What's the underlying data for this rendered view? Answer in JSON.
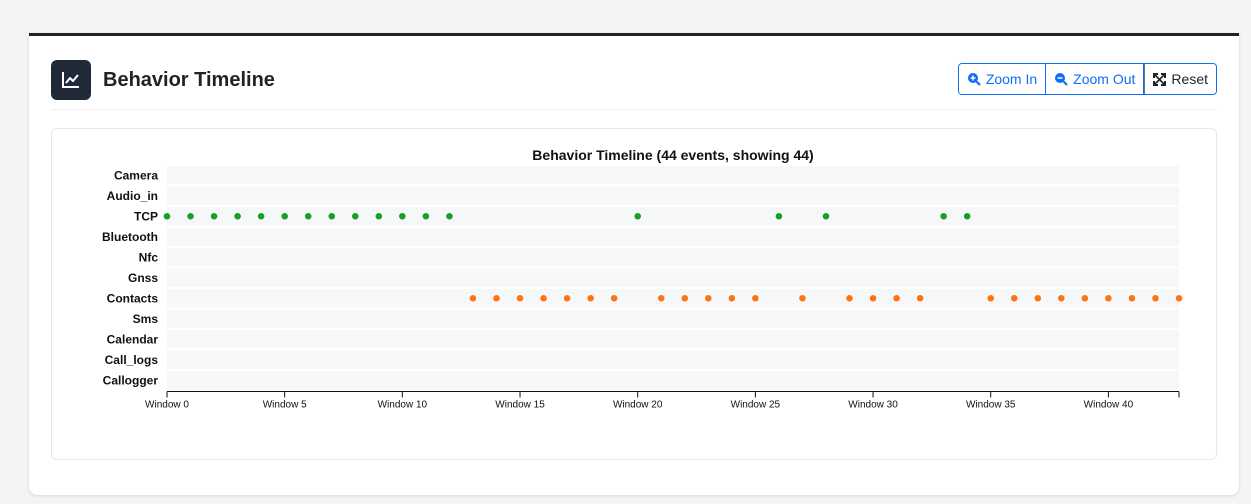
{
  "header": {
    "title": "Behavior Timeline",
    "icon": "line-chart-icon"
  },
  "toolbar": {
    "zoom_in_label": "Zoom In",
    "zoom_out_label": "Zoom Out",
    "reset_label": "Reset"
  },
  "colors": {
    "tcp": "#1a9e2a",
    "contacts": "#ff7410",
    "accent": "#0d6efd"
  },
  "chart_data": {
    "type": "scatter",
    "title": "Behavior Timeline (44 events, showing 44)",
    "lanes": [
      "Camera",
      "Audio_in",
      "TCP",
      "Bluetooth",
      "Nfc",
      "Gnss",
      "Contacts",
      "Sms",
      "Calendar",
      "Call_logs",
      "Callogger"
    ],
    "x_ticks": [
      0,
      5,
      10,
      15,
      20,
      25,
      30,
      35,
      40
    ],
    "x_tick_labels": [
      "Window 0",
      "Window 5",
      "Window 10",
      "Window 15",
      "Window 20",
      "Window 25",
      "Window 30",
      "Window 35",
      "Window 40"
    ],
    "xlim": [
      0,
      43
    ],
    "series": [
      {
        "lane": "TCP",
        "x": [
          0,
          1,
          2,
          3,
          4,
          5,
          6,
          7,
          8,
          9,
          10,
          11,
          12,
          20,
          26,
          28,
          33,
          34
        ]
      },
      {
        "lane": "Contacts",
        "x": [
          13,
          14,
          15,
          16,
          17,
          18,
          19,
          21,
          22,
          23,
          24,
          25,
          27,
          29,
          30,
          31,
          32,
          35,
          36,
          37,
          38,
          39,
          40,
          41,
          42,
          43
        ]
      }
    ]
  }
}
